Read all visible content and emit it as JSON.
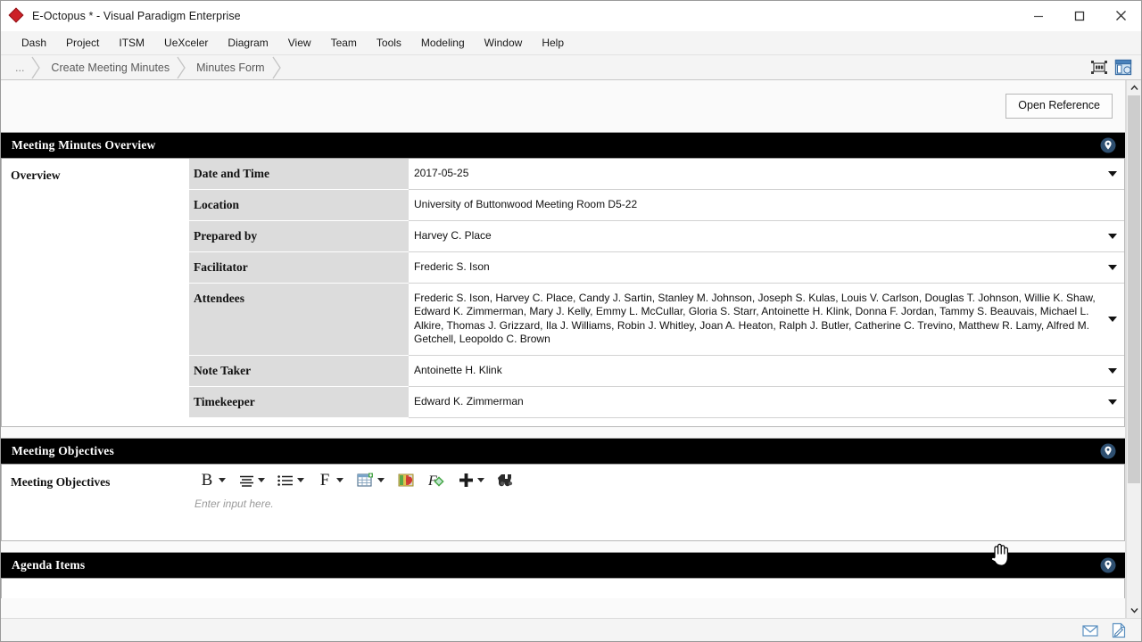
{
  "window": {
    "title": "E-Octopus * - Visual Paradigm Enterprise",
    "app_icon": "diamond-logo-icon",
    "minimize_label": "minimize-icon",
    "maximize_label": "maximize-icon",
    "close_label": "close-icon"
  },
  "menubar": {
    "items": [
      {
        "label": "Dash"
      },
      {
        "label": "Project"
      },
      {
        "label": "ITSM"
      },
      {
        "label": "UeXceler"
      },
      {
        "label": "Diagram"
      },
      {
        "label": "View"
      },
      {
        "label": "Team"
      },
      {
        "label": "Tools"
      },
      {
        "label": "Modeling"
      },
      {
        "label": "Window"
      },
      {
        "label": "Help"
      }
    ]
  },
  "breadcrumb": {
    "items": [
      {
        "label": "..."
      },
      {
        "label": "Create Meeting Minutes"
      },
      {
        "label": "Minutes Form"
      }
    ],
    "tools": [
      {
        "name": "fit-window-icon"
      },
      {
        "name": "panel-layout-icon"
      }
    ]
  },
  "toolbar": {
    "open_reference_label": "Open Reference"
  },
  "sections": [
    {
      "header": "Meeting Minutes Overview",
      "label": "Overview",
      "type": "form",
      "rows": [
        {
          "key": "Date and Time",
          "value": "2017-05-25",
          "dropdown": true
        },
        {
          "key": "Location",
          "value": "University of Buttonwood Meeting Room D5-22",
          "dropdown": false
        },
        {
          "key": "Prepared by",
          "value": "Harvey C. Place",
          "dropdown": true
        },
        {
          "key": "Facilitator",
          "value": "Frederic S. Ison",
          "dropdown": true
        },
        {
          "key": "Attendees",
          "value": "Frederic S. Ison, Harvey C. Place, Candy J. Sartin, Stanley M. Johnson, Joseph S. Kulas, Louis V. Carlson, Douglas T. Johnson, Willie K. Shaw, Edward K. Zimmerman, Mary J. Kelly, Emmy L. McCullar, Gloria S. Starr, Antoinette H. Klink, Donna F. Jordan, Tammy S. Beauvais, Michael L. Alkire, Thomas J. Grizzard, Ila J. Williams, Robin J. Whitley, Joan A. Heaton, Ralph J. Butler, Catherine C. Trevino, Matthew R. Lamy, Alfred M. Getchell, Leopoldo C. Brown",
          "dropdown": true
        },
        {
          "key": "Note Taker",
          "value": "Antoinette H. Klink",
          "dropdown": true
        },
        {
          "key": "Timekeeper",
          "value": "Edward K. Zimmerman",
          "dropdown": true
        }
      ]
    },
    {
      "header": "Meeting Objectives",
      "label": "Meeting Objectives",
      "type": "richtext",
      "placeholder": "Enter input here."
    },
    {
      "header": "Agenda Items",
      "label": "",
      "type": "collapsed"
    }
  ],
  "richtext_toolbar": {
    "buttons": [
      {
        "name": "bold-icon",
        "glyph": "B",
        "has_dropdown": true
      },
      {
        "name": "align-icon",
        "glyph": "align",
        "has_dropdown": true
      },
      {
        "name": "list-icon",
        "glyph": "list",
        "has_dropdown": true
      },
      {
        "name": "font-icon",
        "glyph": "F",
        "has_dropdown": true
      },
      {
        "name": "insert-table-icon",
        "glyph": "table",
        "has_dropdown": true
      },
      {
        "name": "image-icon",
        "glyph": "image",
        "has_dropdown": false
      },
      {
        "name": "format-painter-icon",
        "glyph": "painter",
        "has_dropdown": false
      },
      {
        "name": "insert-icon",
        "glyph": "plus",
        "has_dropdown": true
      },
      {
        "name": "find-icon",
        "glyph": "binoculars",
        "has_dropdown": false
      }
    ]
  },
  "statusbar": {
    "icons": [
      {
        "name": "mail-icon"
      },
      {
        "name": "edit-document-icon"
      }
    ]
  },
  "scrollbar": {
    "up_arrow": "scroll-up-icon",
    "down_arrow": "scroll-down-icon",
    "thumb": "scroll-thumb"
  },
  "colors": {
    "section_header_bg": "#000000",
    "section_header_text": "#ffffff",
    "field_key_bg": "#dcdcdc",
    "accent_pin": "#2e5a87",
    "logo_red": "#cc2127"
  }
}
